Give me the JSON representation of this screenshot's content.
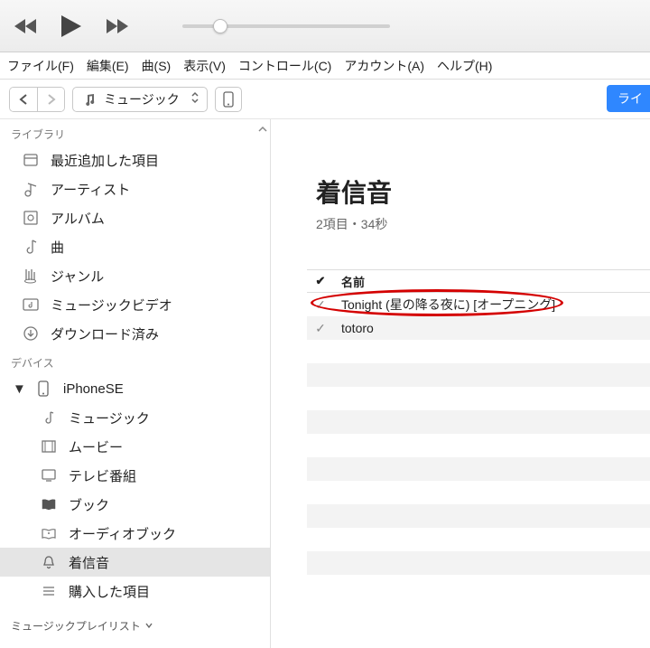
{
  "menu": {
    "file": "ファイル(F)",
    "edit": "編集(E)",
    "song": "曲(S)",
    "view": "表示(V)",
    "control": "コントロール(C)",
    "account": "アカウント(A)",
    "help": "ヘルプ(H)"
  },
  "toolbar": {
    "category_selected": "ミュージック",
    "library_button": "ライ"
  },
  "sidebar": {
    "library_label": "ライブラリ",
    "library_items": [
      {
        "icon": "recent",
        "label": "最近追加した項目"
      },
      {
        "icon": "artist",
        "label": "アーティスト"
      },
      {
        "icon": "album",
        "label": "アルバム"
      },
      {
        "icon": "song",
        "label": "曲"
      },
      {
        "icon": "genre",
        "label": "ジャンル"
      },
      {
        "icon": "mv",
        "label": "ミュージックビデオ"
      },
      {
        "icon": "download",
        "label": "ダウンロード済み"
      }
    ],
    "devices_label": "デバイス",
    "device_name": "iPhoneSE",
    "device_items": [
      {
        "icon": "music",
        "label": "ミュージック"
      },
      {
        "icon": "movie",
        "label": "ムービー"
      },
      {
        "icon": "tv",
        "label": "テレビ番組"
      },
      {
        "icon": "book",
        "label": "ブック"
      },
      {
        "icon": "audiobook",
        "label": "オーディオブック"
      },
      {
        "icon": "ringtone",
        "label": "着信音",
        "selected": true
      },
      {
        "icon": "purchased",
        "label": "購入した項目"
      }
    ],
    "playlists_label": "ミュージックプレイリスト"
  },
  "content": {
    "title": "着信音",
    "subtitle": "2項目・34秒",
    "column_name": "名前",
    "rows": [
      {
        "name": "Tonight (星の降る夜に) [オープニング]",
        "checked": true,
        "highlighted": true
      },
      {
        "name": "totoro",
        "checked": true
      }
    ]
  }
}
